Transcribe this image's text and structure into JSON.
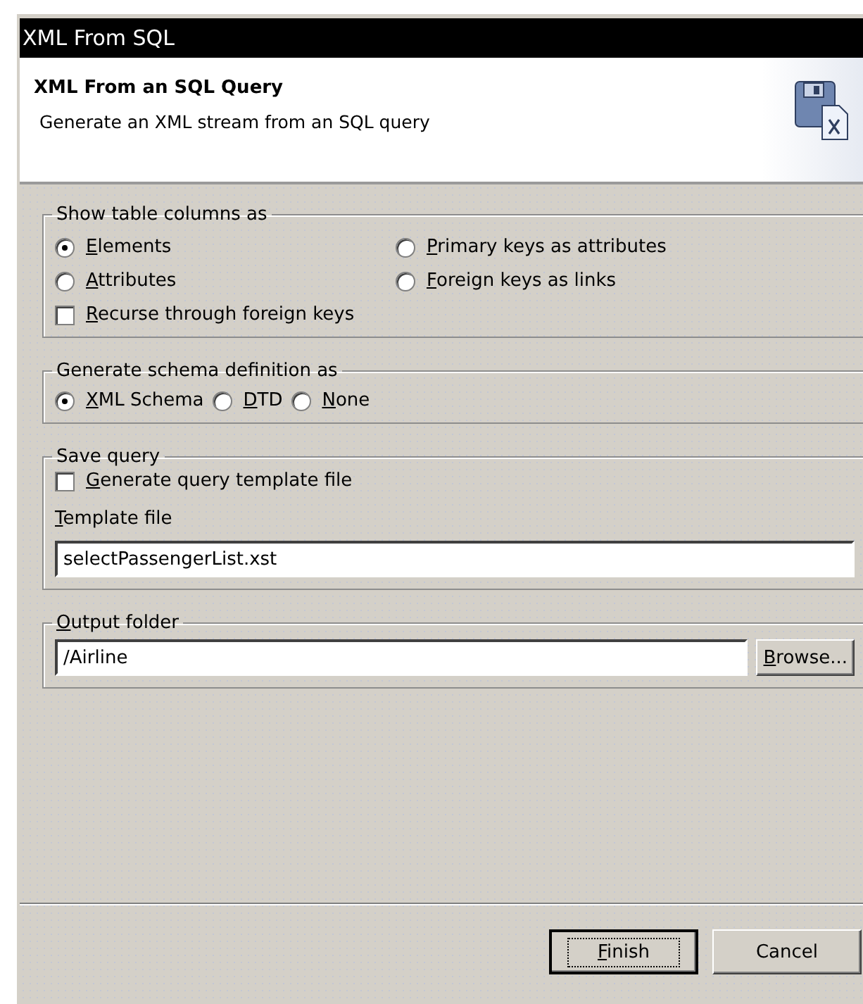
{
  "window": {
    "title": "XML From SQL"
  },
  "header": {
    "title": "XML From an SQL Query",
    "description": "Generate an XML stream from an SQL query"
  },
  "groups": [
    {
      "title": "Show table columns as",
      "options": [
        {
          "kind": "radio",
          "label": "Elements",
          "mnemonic": true,
          "selected": true
        },
        {
          "kind": "radio",
          "label": "Primary keys as attributes",
          "mnemonic": true,
          "selected": false
        },
        {
          "kind": "radio",
          "label": "Attributes",
          "mnemonic": true,
          "selected": false
        },
        {
          "kind": "radio",
          "label": "Foreign keys as links",
          "mnemonic": true,
          "selected": false
        },
        {
          "kind": "checkbox",
          "label": "Recurse through foreign keys",
          "mnemonic": true,
          "checked": false
        }
      ]
    },
    {
      "title": "Generate schema definition as",
      "options": [
        {
          "kind": "radio",
          "label": "XML Schema",
          "mnemonic": true,
          "selected": true
        },
        {
          "kind": "radio",
          "label": "DTD",
          "mnemonic": true,
          "selected": false
        },
        {
          "kind": "radio",
          "label": "None",
          "mnemonic": true,
          "selected": false
        }
      ]
    }
  ],
  "save_query": {
    "title": "Save query",
    "checkbox": {
      "label": "Generate query template file",
      "mnemonic": true,
      "checked": false
    },
    "field_label": {
      "label": "Template file",
      "mnemonic": true
    },
    "value": "selectPassengerList.xst"
  },
  "output_folder": {
    "title": {
      "label": "Output folder",
      "mnemonic": true
    },
    "value": "/Airline",
    "browse": {
      "label": "Browse...",
      "mnemonic": true
    }
  },
  "buttons": [
    {
      "label": "Finish",
      "mnemonic": true,
      "default": true
    },
    {
      "label": "Cancel",
      "mnemonic": false,
      "default": false
    }
  ]
}
